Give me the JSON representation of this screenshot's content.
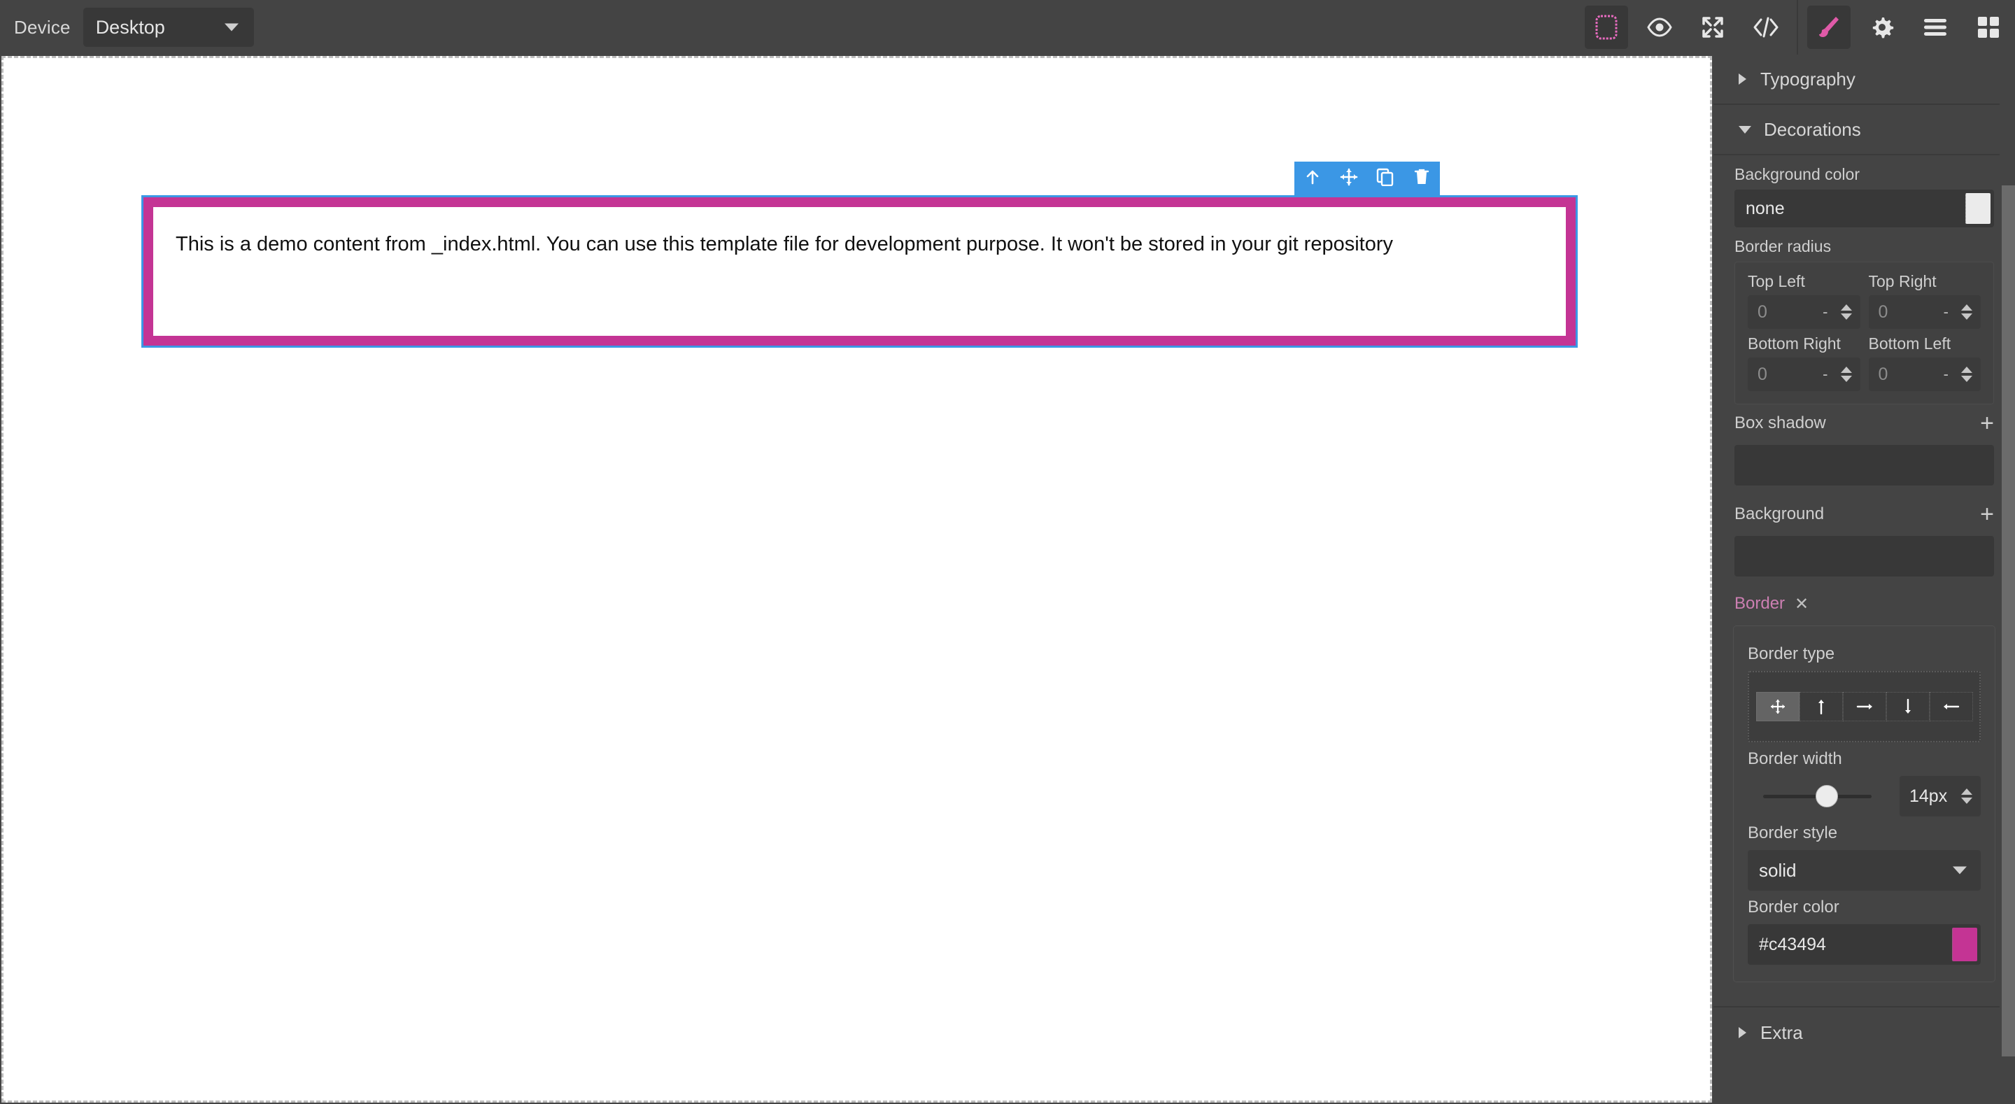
{
  "topbar": {
    "device_label": "Device",
    "device_value": "Desktop",
    "buttons": [
      {
        "name": "borders-visibility-icon",
        "title": "Toggle borders",
        "active": true
      },
      {
        "name": "preview-eye-icon",
        "title": "Preview",
        "active": false
      },
      {
        "name": "fullscreen-icon",
        "title": "Fullscreen",
        "active": false
      },
      {
        "name": "code-icon",
        "title": "View code",
        "active": false
      },
      {
        "name": "paint-brush-icon",
        "title": "Open Style Manager",
        "active": true
      },
      {
        "name": "gear-icon",
        "title": "Settings",
        "active": false
      },
      {
        "name": "layers-icon",
        "title": "Layer Manager",
        "active": false
      },
      {
        "name": "blocks-icon",
        "title": "Blocks",
        "active": false
      }
    ]
  },
  "canvas": {
    "selected_element_text": "This is a demo content from _index.html. You can use this template file for development purpose. It won't be stored in your git repository",
    "selection_outline_color": "#3b97e5",
    "element_border_color": "#c43494",
    "element_border_width": "14px",
    "toolbar": [
      {
        "name": "select-parent-icon",
        "label": "Select parent"
      },
      {
        "name": "move-icon",
        "label": "Move"
      },
      {
        "name": "copy-icon",
        "label": "Duplicate"
      },
      {
        "name": "trash-icon",
        "label": "Delete"
      }
    ]
  },
  "panel": {
    "sectors": {
      "typography": {
        "title": "Typography",
        "open": false
      },
      "decorations": {
        "title": "Decorations",
        "open": true
      },
      "extra": {
        "title": "Extra",
        "open": false
      }
    },
    "background_color": {
      "label": "Background color",
      "value": "none",
      "swatch": "#ebebeb"
    },
    "border_radius": {
      "label": "Border radius",
      "corners": [
        {
          "label": "Top Left",
          "placeholder": "0",
          "unit": "-"
        },
        {
          "label": "Top Right",
          "placeholder": "0",
          "unit": "-"
        },
        {
          "label": "Bottom Right",
          "placeholder": "0",
          "unit": "-"
        },
        {
          "label": "Bottom Left",
          "placeholder": "0",
          "unit": "-"
        }
      ]
    },
    "box_shadow": {
      "label": "Box shadow",
      "add": "+"
    },
    "background": {
      "label": "Background",
      "add": "+"
    },
    "border": {
      "layer_label": "Border",
      "layer_close": "✕",
      "border_type": {
        "label": "Border type",
        "options": [
          {
            "name": "border-all-icon",
            "active": true
          },
          {
            "name": "border-top-icon",
            "active": false
          },
          {
            "name": "border-right-icon",
            "active": false
          },
          {
            "name": "border-bottom-icon",
            "active": false
          },
          {
            "name": "border-left-icon",
            "active": false
          }
        ]
      },
      "border_width": {
        "label": "Border width",
        "value": "14px",
        "slider_percent": 57
      },
      "border_style": {
        "label": "Border style",
        "value": "solid"
      },
      "border_color": {
        "label": "Border color",
        "value": "#c43494",
        "swatch": "#c43494"
      }
    }
  }
}
